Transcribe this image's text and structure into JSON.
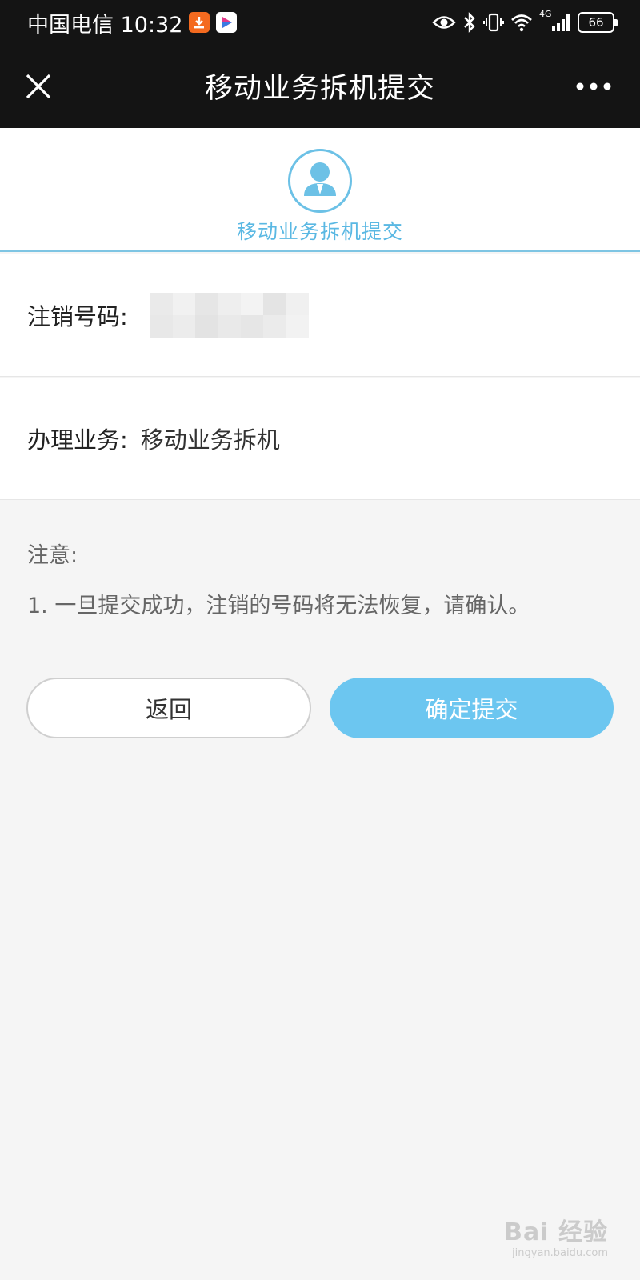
{
  "status_bar": {
    "carrier_time": "中国电信 10:32",
    "network": "4G",
    "battery": "66",
    "icons": [
      "download-icon",
      "video-app-icon",
      "eye-icon",
      "bluetooth-icon",
      "vibrate-icon",
      "wifi-icon",
      "signal-icon",
      "battery-icon"
    ]
  },
  "nav": {
    "title": "移动业务拆机提交",
    "close_icon": "close-icon",
    "more_icon": "more-icon"
  },
  "header": {
    "icon": "user-avatar-icon",
    "title": "移动业务拆机提交",
    "accent_color": "#5ab8e3"
  },
  "form": {
    "number_label": "注销号码:",
    "number_value_masked": true,
    "service_label": "办理业务:",
    "service_value": "移动业务拆机"
  },
  "notice": {
    "title": "注意:",
    "items": [
      "1. 一旦提交成功，注销的号码将无法恢复，请确认。"
    ]
  },
  "buttons": {
    "back_label": "返回",
    "submit_label": "确定提交",
    "submit_color": "#6cc6f0"
  },
  "watermark": {
    "main": "Bai 经验",
    "sub": "jingyan.baidu.com"
  }
}
